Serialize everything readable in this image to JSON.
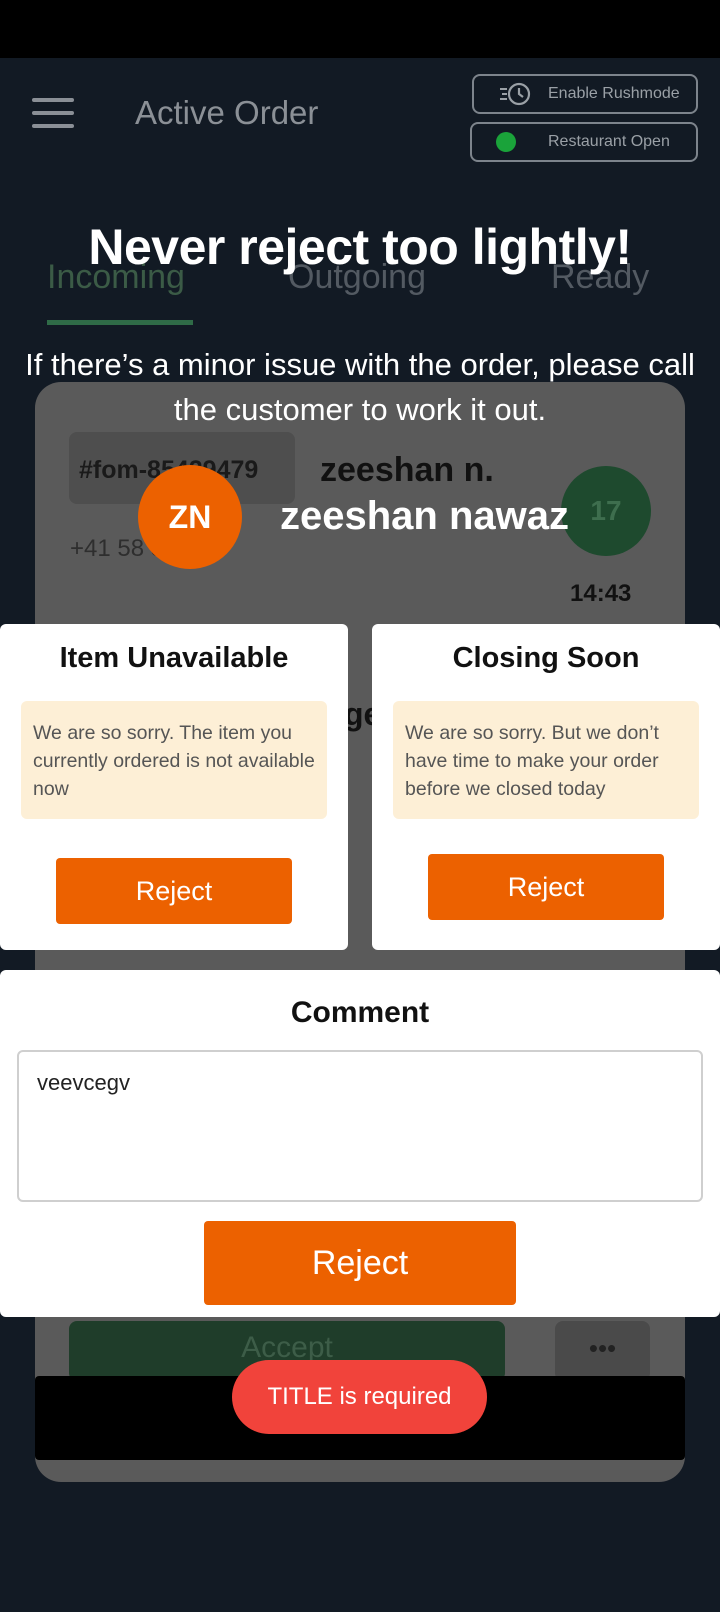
{
  "app": {
    "title": "Active Order",
    "rushmode_label": "Enable Rushmode",
    "restaurant_status": "Restaurant Open",
    "tabs": [
      {
        "label": "Incoming"
      },
      {
        "label": "Outgoing"
      },
      {
        "label": "Ready"
      }
    ]
  },
  "order": {
    "id": "#fom-85429479",
    "customer_short": "zeeshan n.",
    "phone": "+41 58 3777",
    "item_count": "17",
    "time": "14:43",
    "accept_label": "Accept",
    "more_label": "•••"
  },
  "dialog": {
    "headline": "Never reject too lightly!",
    "subline": "If there’s a minor issue with the order, please call the customer to work it out.",
    "avatar_initials": "ZN",
    "customer_name": "zeeshan nawaz",
    "reasons": [
      {
        "title": "Item Unavailable",
        "message": "We are so sorry. The item you currently ordered is not available now",
        "button": "Reject"
      },
      {
        "title": "Closing Soon",
        "message": "We are so sorry. But we don’t have time to make your order before we closed today",
        "button": "Reject"
      }
    ],
    "comment": {
      "title": "Comment",
      "value": "veevcegv",
      "button": "Reject"
    }
  },
  "toast": {
    "message": "TITLE is required"
  },
  "colors": {
    "accent": "#ec6100",
    "toast": "#f1433b",
    "reason_bg": "#fdefd6",
    "status_open": "#1aa33a"
  }
}
